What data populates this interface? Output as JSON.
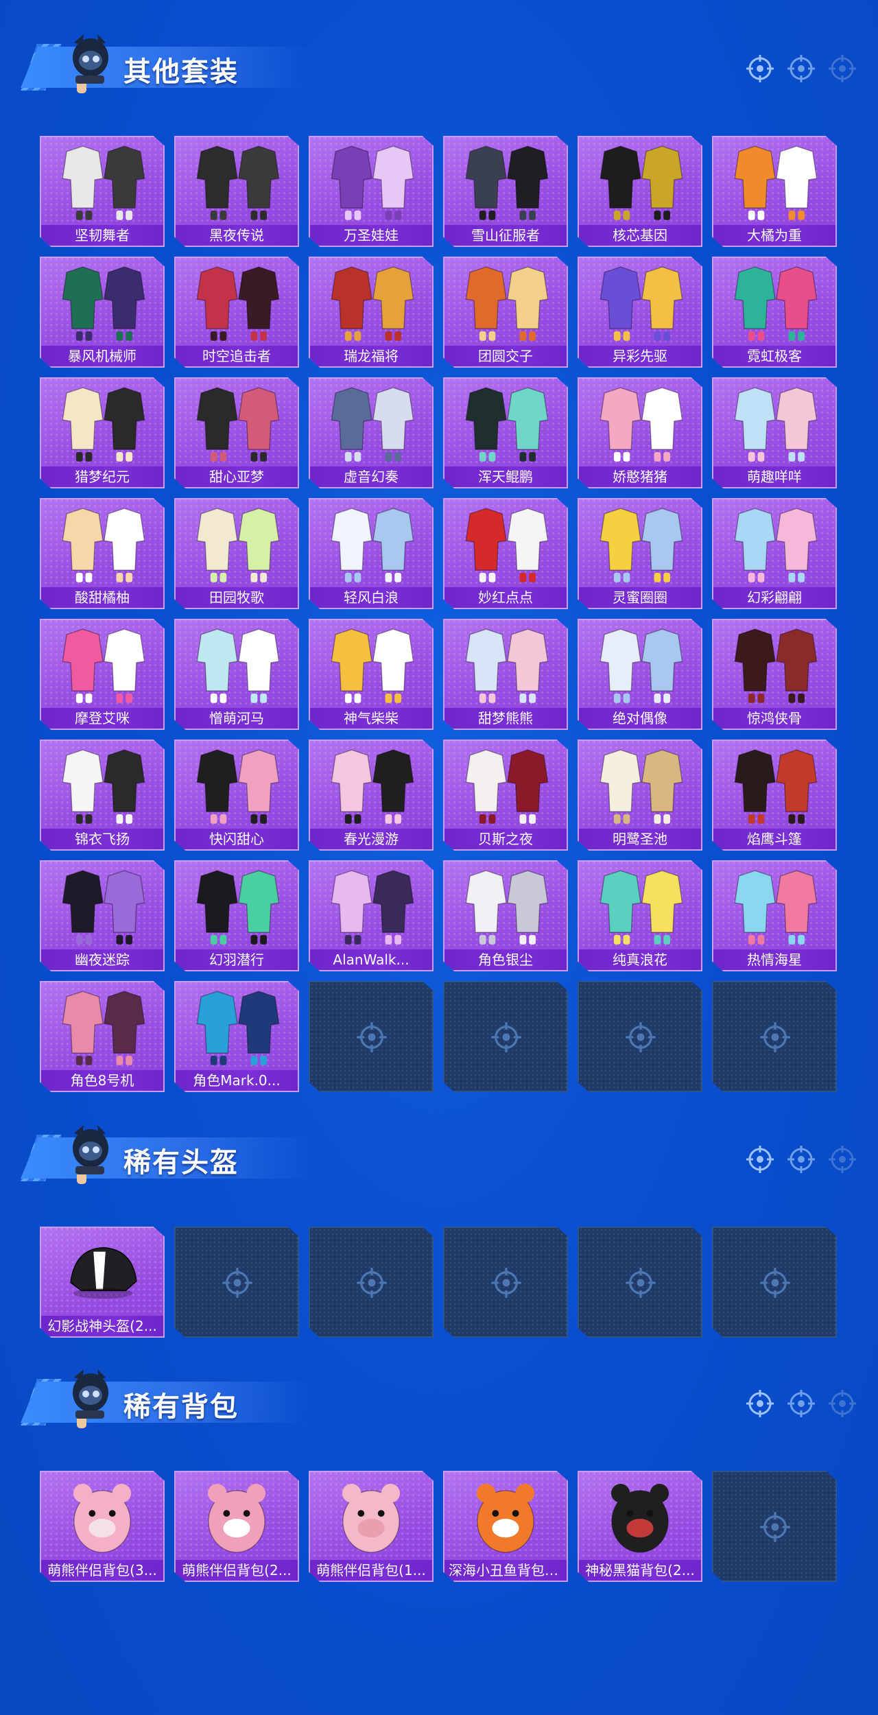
{
  "sections": {
    "outfits": {
      "title": "其他套装",
      "items": [
        {
          "name": "坚韧舞者",
          "hue": "#e8e8e8",
          "hue2": "#3a3a3a"
        },
        {
          "name": "黑夜传说",
          "hue": "#2c2c2c",
          "hue2": "#3a3a3a"
        },
        {
          "name": "万圣娃娃",
          "hue": "#7a3fb5",
          "hue2": "#e8c6f5"
        },
        {
          "name": "雪山征服者",
          "hue": "#3b3f52",
          "hue2": "#1e1e24"
        },
        {
          "name": "核芯基因",
          "hue": "#1d1d1d",
          "hue2": "#c9a528"
        },
        {
          "name": "大橘为重",
          "hue": "#f08a2a",
          "hue2": "#ffffff"
        },
        {
          "name": "暴风机械师",
          "hue": "#1f6f55",
          "hue2": "#3b2c6e"
        },
        {
          "name": "时空追击者",
          "hue": "#c2334a",
          "hue2": "#3a1a24"
        },
        {
          "name": "瑞龙福将",
          "hue": "#b8322a",
          "hue2": "#e6a23a"
        },
        {
          "name": "团圆交子",
          "hue": "#e06a2c",
          "hue2": "#f4d08a"
        },
        {
          "name": "异彩先驱",
          "hue": "#6a4fd6",
          "hue2": "#f2c044"
        },
        {
          "name": "霓虹极客",
          "hue": "#2cb39a",
          "hue2": "#e84f8a"
        },
        {
          "name": "猎梦纪元",
          "hue": "#f5e6c8",
          "hue2": "#2a2a2a"
        },
        {
          "name": "甜心亚梦",
          "hue": "#2a2a2a",
          "hue2": "#d45a7a"
        },
        {
          "name": "虚音幻奏",
          "hue": "#5a6a9a",
          "hue2": "#d8dcef"
        },
        {
          "name": "浑天鲲鹏",
          "hue": "#1f2f2f",
          "hue2": "#6fd6c8"
        },
        {
          "name": "娇憨猪猪",
          "hue": "#f5a8c4",
          "hue2": "#ffffff"
        },
        {
          "name": "萌趣咩咩",
          "hue": "#bfe0f5",
          "hue2": "#f5c6d8"
        },
        {
          "name": "酸甜橘柚",
          "hue": "#f6d8a8",
          "hue2": "#ffffff"
        },
        {
          "name": "田园牧歌",
          "hue": "#f2ead0",
          "hue2": "#d6f0a8"
        },
        {
          "name": "轻风白浪",
          "hue": "#f0f4ff",
          "hue2": "#a8c8f0"
        },
        {
          "name": "妙红点点",
          "hue": "#d42a2a",
          "hue2": "#f5f5f5"
        },
        {
          "name": "灵蜜圈圈",
          "hue": "#f5d040",
          "hue2": "#a8c8f0"
        },
        {
          "name": "幻彩翩翩",
          "hue": "#a8d8f5",
          "hue2": "#f5b8d8"
        },
        {
          "name": "摩登艾咪",
          "hue": "#f05aa0",
          "hue2": "#ffffff"
        },
        {
          "name": "憎萌河马",
          "hue": "#bfe8f0",
          "hue2": "#ffffff"
        },
        {
          "name": "神气柴柴",
          "hue": "#f5c040",
          "hue2": "#ffffff"
        },
        {
          "name": "甜梦熊熊",
          "hue": "#d8e4f8",
          "hue2": "#f5c6d8"
        },
        {
          "name": "绝对偶像",
          "hue": "#e8eef8",
          "hue2": "#a8c8f0"
        },
        {
          "name": "惊鸿侠骨",
          "hue": "#3a1a1a",
          "hue2": "#8a2a2a"
        },
        {
          "name": "锦衣飞扬",
          "hue": "#f5f5f5",
          "hue2": "#2a2a2a"
        },
        {
          "name": "快闪甜心",
          "hue": "#1f1f1f",
          "hue2": "#f0a0c0"
        },
        {
          "name": "春光漫游",
          "hue": "#f5c6e0",
          "hue2": "#1f1f1f"
        },
        {
          "name": "贝斯之夜",
          "hue": "#f5f0f0",
          "hue2": "#8a1a2a"
        },
        {
          "name": "明鹭圣池",
          "hue": "#f5efe0",
          "hue2": "#d8b880"
        },
        {
          "name": "焰鹰斗篷",
          "hue": "#2a1a1a",
          "hue2": "#c23a2a"
        },
        {
          "name": "幽夜迷踪",
          "hue": "#1f1a2a",
          "hue2": "#9a6ad8"
        },
        {
          "name": "幻羽潜行",
          "hue": "#1a1a1f",
          "hue2": "#4ad0a0"
        },
        {
          "name": "AlanWalk...",
          "hue": "#e8b8f0",
          "hue2": "#3a2a5a"
        },
        {
          "name": "角色银尘",
          "hue": "#f0f0f5",
          "hue2": "#c8c8d8"
        },
        {
          "name": "纯真浪花",
          "hue": "#5ad0c0",
          "hue2": "#f5e060"
        },
        {
          "name": "热情海星",
          "hue": "#8ad8f0",
          "hue2": "#f07aa0"
        },
        {
          "name": "角色8号机",
          "hue": "#e88aa8",
          "hue2": "#5a2a4a"
        },
        {
          "name": "角色Mark.0...",
          "hue": "#2aa0d8",
          "hue2": "#1f3a7a"
        }
      ],
      "empty_slots": 4
    },
    "helmets": {
      "title": "稀有头盔",
      "items": [
        {
          "name": "幻影战神头盔(2...",
          "hue": "#1f1f24",
          "hue2": "#ffffff"
        }
      ],
      "empty_slots": 5
    },
    "backpacks": {
      "title": "稀有背包",
      "items": [
        {
          "name": "萌熊伴侣背包(3...",
          "hue": "#f5b0c8",
          "hue2": "#f5e0ea"
        },
        {
          "name": "萌熊伴侣背包(2...",
          "hue": "#f0a0b8",
          "hue2": "#ffffff"
        },
        {
          "name": "萌熊伴侣背包(1...",
          "hue": "#f5b8c8",
          "hue2": "#e8a0b0"
        },
        {
          "name": "深海小丑鱼背包(...",
          "hue": "#f07a2a",
          "hue2": "#ffffff"
        },
        {
          "name": "神秘黑猫背包(2...",
          "hue": "#1f1f1f",
          "hue2": "#c23a3a"
        }
      ],
      "empty_slots": 1
    }
  },
  "icons": {
    "header_decoration": "crosshair-icon",
    "empty_slot": "crosshair-icon",
    "card_art": "outfit-thumbnail"
  },
  "colors": {
    "background": "#0a4fd0",
    "card_filled": "#9a4fe3",
    "card_label": "#7b2fd6",
    "card_empty": "#1f3a66"
  }
}
